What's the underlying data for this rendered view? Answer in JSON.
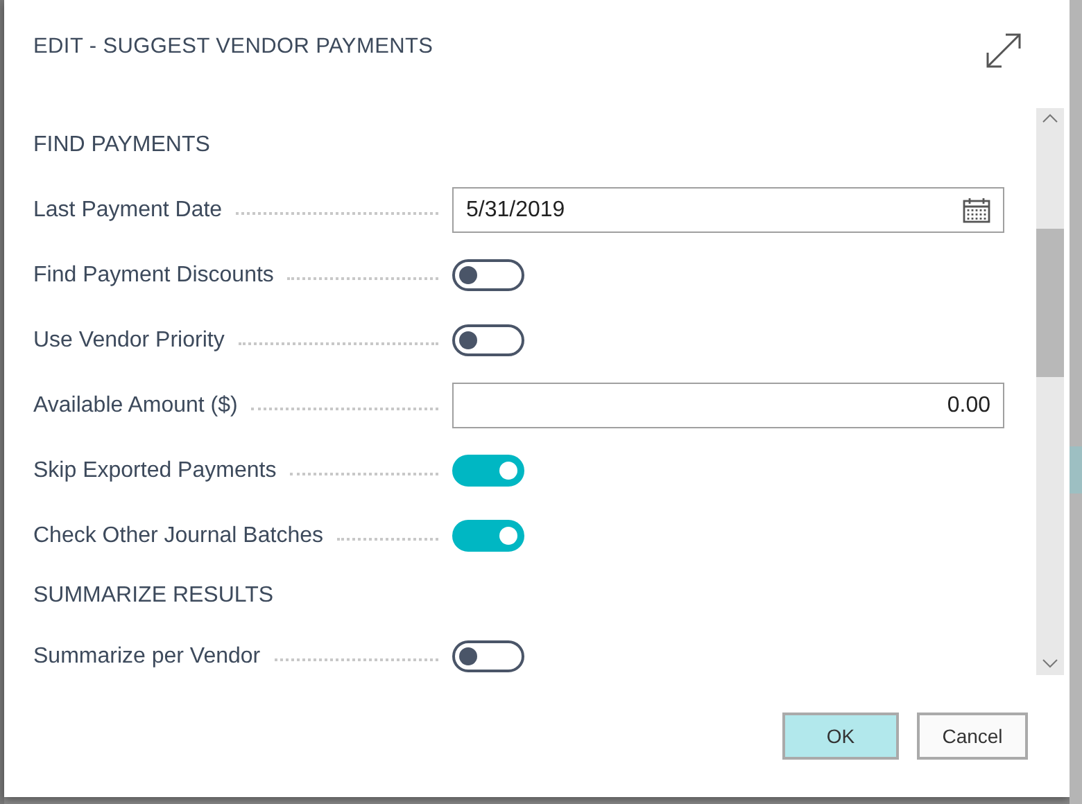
{
  "dialog": {
    "title": "EDIT - SUGGEST VENDOR PAYMENTS"
  },
  "sections": [
    {
      "heading": "FIND PAYMENTS",
      "fields": [
        {
          "kind": "date",
          "label": "Last Payment Date",
          "value": "5/31/2019"
        },
        {
          "kind": "toggle",
          "label": "Find Payment Discounts",
          "on": false
        },
        {
          "kind": "toggle",
          "label": "Use Vendor Priority",
          "on": false
        },
        {
          "kind": "number",
          "label": "Available Amount ($)",
          "value": "0.00"
        },
        {
          "kind": "toggle",
          "label": "Skip Exported Payments",
          "on": true
        },
        {
          "kind": "toggle",
          "label": "Check Other Journal Batches",
          "on": true
        }
      ]
    },
    {
      "heading": "SUMMARIZE RESULTS",
      "fields": [
        {
          "kind": "toggle",
          "label": "Summarize per Vendor",
          "on": false
        }
      ]
    }
  ],
  "buttons": [
    {
      "label": "OK",
      "kind": "primary"
    },
    {
      "label": "Cancel",
      "kind": "secondary"
    }
  ]
}
